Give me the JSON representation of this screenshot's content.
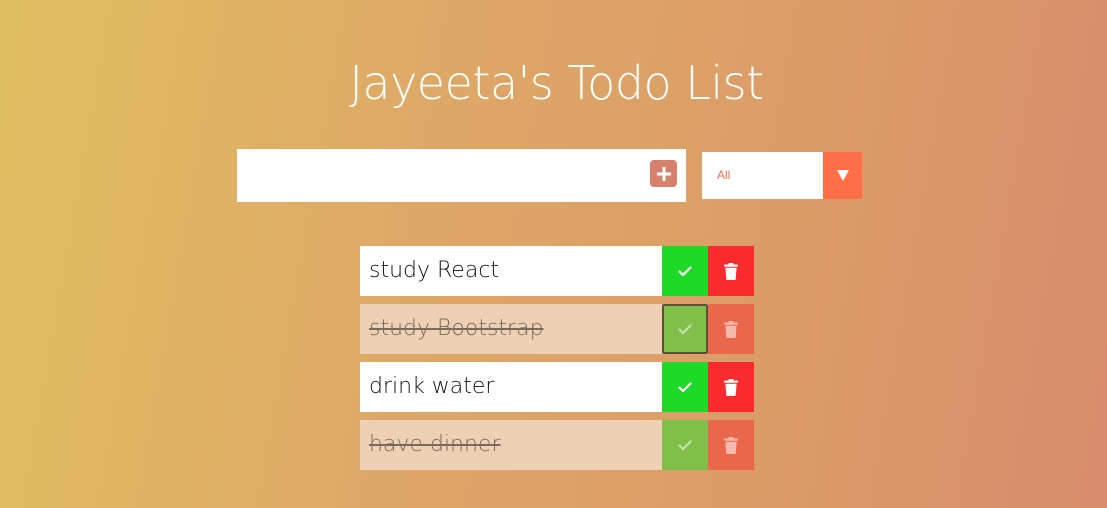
{
  "header": {
    "title": "Jayeeta's Todo List"
  },
  "form": {
    "input_value": "",
    "input_placeholder": "",
    "add_icon": "plus-square-icon",
    "filter_selected": "All",
    "filter_arrow_icon": "caret-down-icon"
  },
  "todos": [
    {
      "text": "study React",
      "completed": false
    },
    {
      "text": "study Bootstrap",
      "completed": true
    },
    {
      "text": "drink water",
      "completed": false
    },
    {
      "text": "have dinner",
      "completed": true
    }
  ],
  "icons": {
    "complete": "check-icon",
    "delete": "trash-icon"
  },
  "colors": {
    "gradient_start": "#e1be61",
    "gradient_end": "#d98c6d",
    "add_button": "#d7806c",
    "select_arrow_bg": "#ff6f47",
    "check_active": "#1ed925",
    "check_completed": "#80bf4a",
    "trash_active": "#fb2a2f",
    "trash_completed": "#ea674c",
    "completed_row_bg": "#eed1b4"
  }
}
